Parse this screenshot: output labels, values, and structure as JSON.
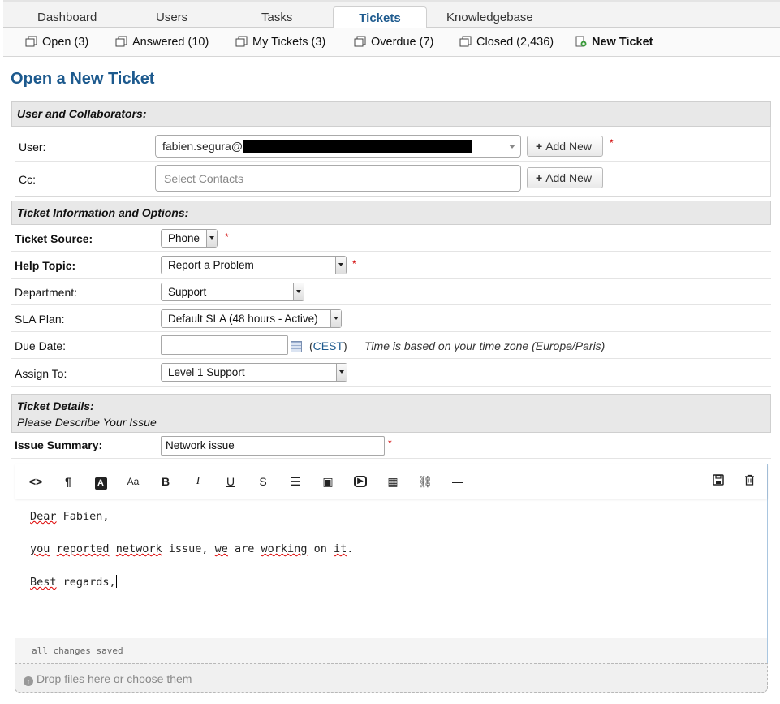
{
  "top_tabs": [
    {
      "label": "Dashboard"
    },
    {
      "label": "Users"
    },
    {
      "label": "Tasks"
    },
    {
      "label": "Tickets",
      "active": true
    },
    {
      "label": "Knowledgebase"
    }
  ],
  "sub_nav": [
    {
      "label": "Open (3)",
      "icon": "copy-icon"
    },
    {
      "label": "Answered (10)",
      "icon": "copy-icon"
    },
    {
      "label": "My Tickets (3)",
      "icon": "copy-icon"
    },
    {
      "label": "Overdue (7)",
      "icon": "copy-icon"
    },
    {
      "label": "Closed (2,436)",
      "icon": "copy-icon"
    },
    {
      "label": "New Ticket",
      "icon": "new-ticket-icon"
    }
  ],
  "page_title": "Open a New Ticket",
  "user_section": {
    "heading": "User and Collaborators:",
    "user_label": "User:",
    "user_value": "fabien.segura@",
    "cc_label": "Cc:",
    "cc_placeholder": "Select Contacts",
    "add_new_label": "Add New",
    "required_mark": "*"
  },
  "ticket_info": {
    "heading": "Ticket Information and Options:",
    "fields": {
      "source": {
        "label": "Ticket Source:",
        "value": "Phone"
      },
      "help_topic": {
        "label": "Help Topic:",
        "value": "Report a Problem"
      },
      "department": {
        "label": "Department:",
        "value": "Support"
      },
      "sla": {
        "label": "SLA Plan:",
        "value": "Default SLA (48 hours - Active)"
      },
      "due_date": {
        "label": "Due Date:",
        "value": "",
        "tz_open": "(",
        "tz": "CEST",
        "tz_close": ")",
        "note": "Time is based on your time zone (Europe/Paris)"
      },
      "assign": {
        "label": "Assign To:",
        "value": "Level 1 Support"
      }
    }
  },
  "ticket_details": {
    "heading": "Ticket Details:",
    "subheading": "Please Describe Your Issue",
    "summary_label": "Issue Summary:",
    "summary_value": "Network issue"
  },
  "editor": {
    "toolbar_icons": [
      "html-icon",
      "paragraph-icon",
      "font-color-icon",
      "font-size-icon",
      "bold-icon",
      "italic-icon",
      "underline-icon",
      "strikethrough-icon",
      "list-icon",
      "image-icon",
      "video-icon",
      "table-icon",
      "link-icon",
      "horizontal-rule-icon",
      "save-draft-icon",
      "delete-draft-icon"
    ],
    "toolbar_glyphs": {
      "html": "<>",
      "paragraph": "¶",
      "fontcolor": "A",
      "fontsize": "Aa",
      "bold": "B",
      "italic": "I",
      "underline": "U",
      "strike": "S",
      "list": "☰",
      "image": "▣",
      "video": "▶",
      "table": "▦",
      "link": "⛓",
      "hr": "—",
      "save": "💾",
      "trash": "🗑"
    },
    "lines": {
      "greeting_word": "Dear",
      "greeting_rest": " Fabien,",
      "line2": [
        "you",
        " ",
        "reported",
        " ",
        "network",
        " issue, ",
        "we",
        " are ",
        "working",
        " on ",
        "it",
        "."
      ],
      "line3_word": "Best",
      "line3_rest": " regards,"
    },
    "status": "all changes saved"
  },
  "dropzone": {
    "text": "Drop files here or",
    "link": "choose them"
  }
}
